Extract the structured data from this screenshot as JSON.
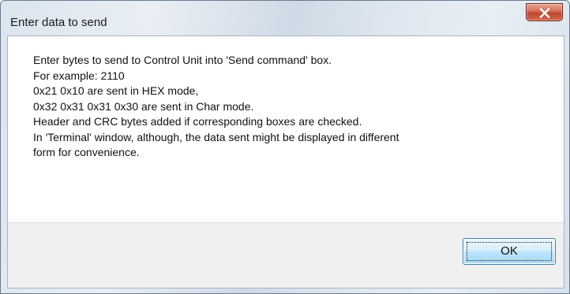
{
  "window": {
    "title": "Enter data to send",
    "close_icon": "close-x-icon"
  },
  "message": {
    "lines": [
      "Enter bytes to send to Control Unit into 'Send command' box.",
      "For example: 2110",
      "0x21 0x10 are sent in HEX mode,",
      "0x32 0x31 0x31 0x30 are sent in Char mode.",
      "Header and CRC bytes added if corresponding boxes are checked.",
      "In 'Terminal' window, although, the data sent might be displayed in different",
      "form for convenience."
    ]
  },
  "buttons": {
    "ok_label": "OK"
  },
  "colors": {
    "close_button": "#c9503a",
    "ok_button_border": "#3c7fb1",
    "footer_background": "#f0f0f0"
  }
}
